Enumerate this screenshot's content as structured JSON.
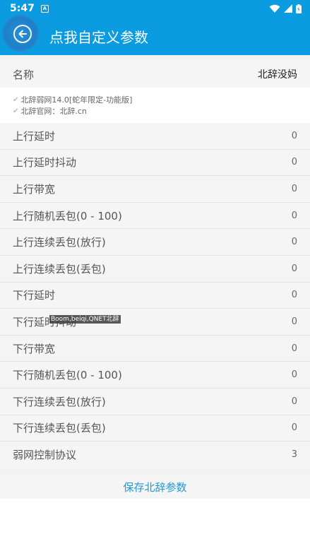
{
  "status_bar": {
    "time": "5:47",
    "notification_glyph": "A",
    "icons": [
      "wifi-icon",
      "signal-icon",
      "battery-icon"
    ]
  },
  "app_bar": {
    "title": "点我自定义参数",
    "back_icon": "back-arrow-icon",
    "color": "#0a9be0"
  },
  "name_row": {
    "label": "名称",
    "value": "北辞没妈"
  },
  "notes": [
    "北辞弱网14.0[蛇年限定-功能版]",
    "北辞官网：北辞.cn"
  ],
  "params": [
    {
      "label": "上行延时",
      "value": "0"
    },
    {
      "label": "上行延时抖动",
      "value": "0"
    },
    {
      "label": "上行带宽",
      "value": "0"
    },
    {
      "label": "上行随机丢包(0 - 100)",
      "value": "0"
    },
    {
      "label": "上行连续丢包(放行)",
      "value": "0"
    },
    {
      "label": "上行连续丢包(丢包)",
      "value": "0"
    },
    {
      "label": "下行延时",
      "value": "0"
    },
    {
      "label": "下行延时抖动",
      "value": "0"
    },
    {
      "label": "下行带宽",
      "value": "0"
    },
    {
      "label": "下行随机丢包(0 - 100)",
      "value": "0"
    },
    {
      "label": "下行连续丢包(放行)",
      "value": "0"
    },
    {
      "label": "下行连续丢包(丢包)",
      "value": "0"
    },
    {
      "label": "弱网控制协议",
      "value": "3"
    }
  ],
  "watermark": "Boom,beiqi,QNET北辞",
  "save_button": "保存北辞参数",
  "accent_color": "#1a9ad6"
}
